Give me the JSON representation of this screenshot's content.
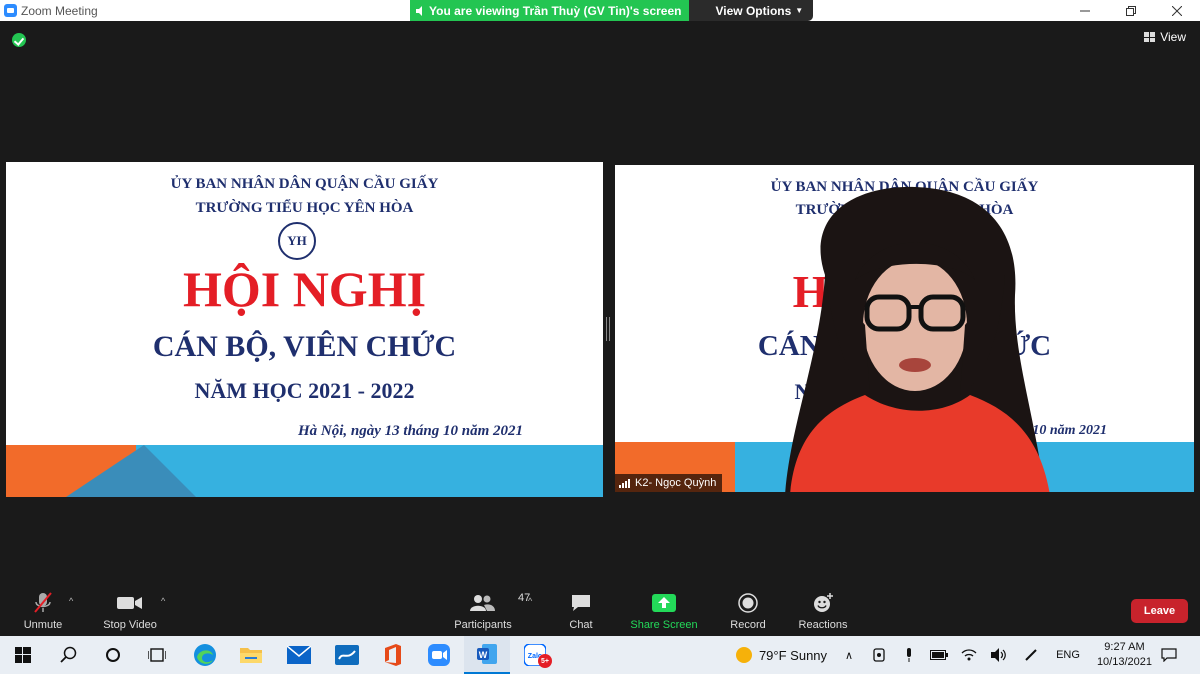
{
  "window": {
    "title": "Zoom Meeting",
    "controls": [
      "minimize",
      "restore",
      "close"
    ]
  },
  "banner": {
    "viewing_text": "You are viewing Trần Thuỳ (GV Tin)'s screen",
    "view_options_label": "View Options"
  },
  "top_right": {
    "view_label": "View"
  },
  "slide": {
    "line1": "ỦY BAN NHÂN DÂN QUẬN CẦU GIẤY",
    "line2": "TRƯỜNG TIỂU HỌC YÊN HÒA",
    "logo_text": "YH",
    "title": "HỘI NGHỊ",
    "subtitle": "CÁN BỘ, VIÊN CHỨC",
    "year": "NĂM HỌC 2021 - 2022",
    "date": "Hà Nội, ngày 13 tháng 10 năm 2021"
  },
  "participant_video": {
    "name": "K2- Ngọc Quỳnh"
  },
  "toolbar": {
    "unmute_label": "Unmute",
    "stop_video_label": "Stop Video",
    "participants_label": "Participants",
    "participants_count": "47",
    "chat_label": "Chat",
    "share_screen_label": "Share Screen",
    "record_label": "Record",
    "reactions_label": "Reactions",
    "leave_label": "Leave"
  },
  "taskbar": {
    "apps": [
      "start",
      "search",
      "cortana",
      "task-view",
      "edge",
      "file-explorer",
      "mail",
      "whiteboard",
      "office",
      "zoom",
      "word",
      "zalo"
    ],
    "zalo_badge": "5+",
    "weather": "79°F  Sunny",
    "language": "ENG",
    "time": "9:27 AM",
    "date": "10/13/2021"
  },
  "colors": {
    "zoom_blue": "#2d8cff",
    "banner_green": "#23c552",
    "share_green": "#23d959",
    "leave_red": "#c8232c",
    "slide_red": "#e41e26",
    "slide_navy": "#1f2f6e"
  }
}
